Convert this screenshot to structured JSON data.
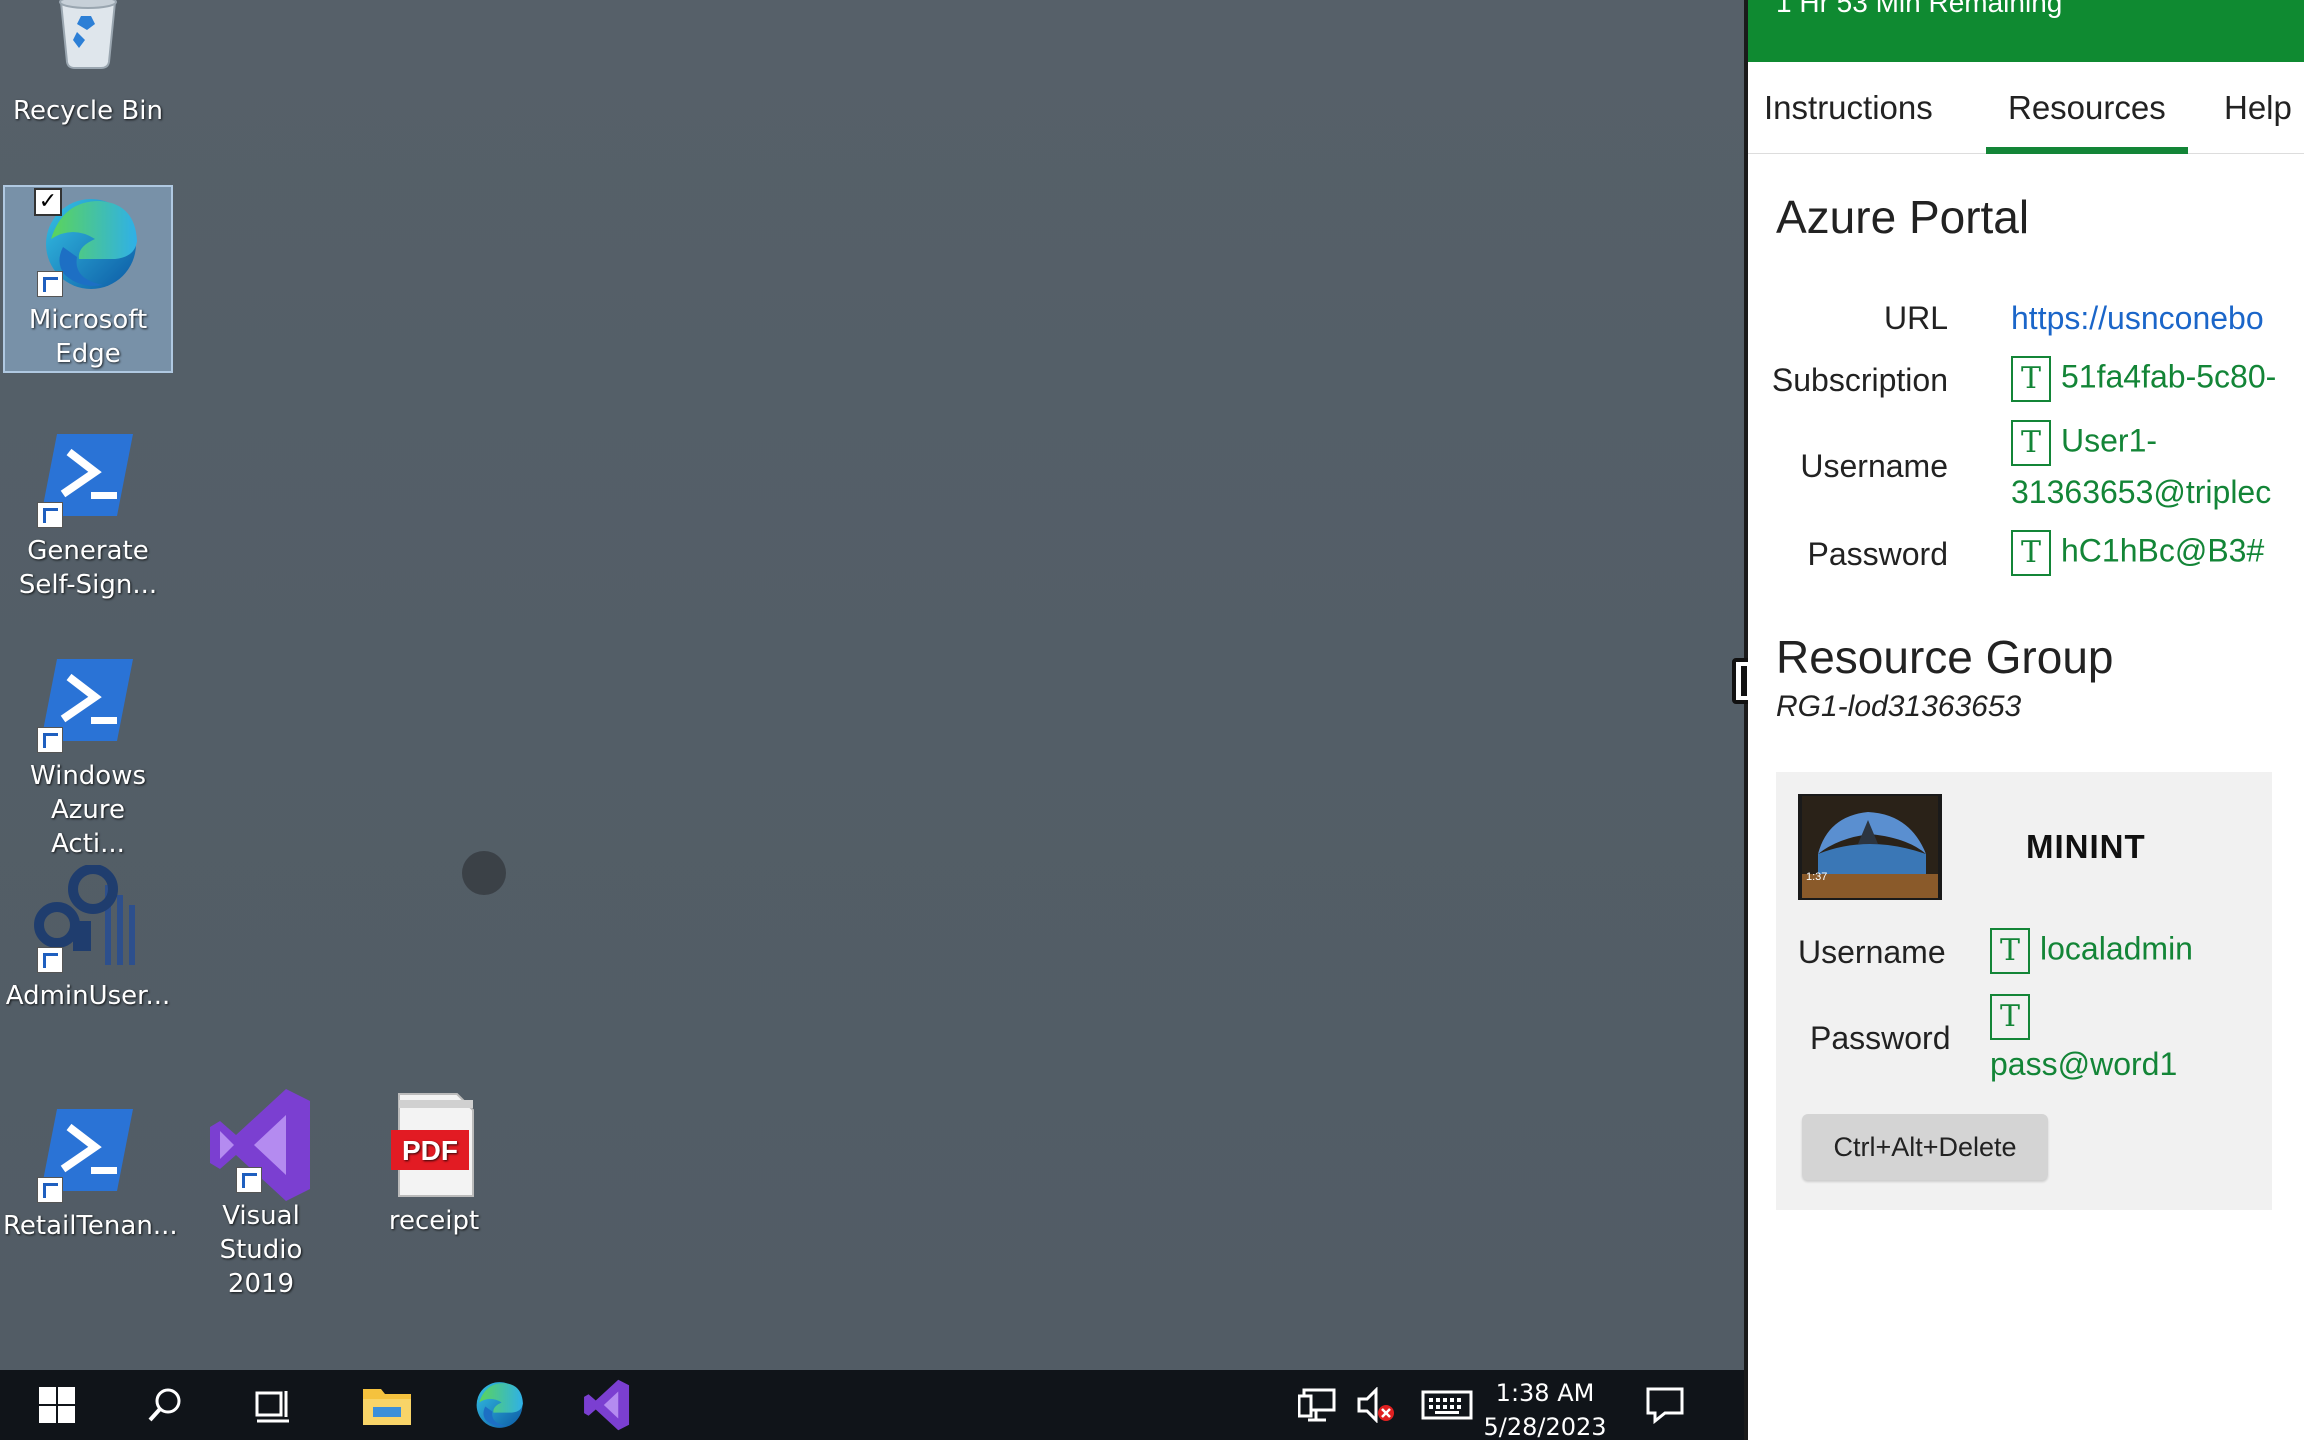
{
  "desktop": {
    "icons": [
      {
        "label": "Recycle Bin"
      },
      {
        "label": "Microsoft Edge"
      },
      {
        "label": "Generate Self-Sign..."
      },
      {
        "label": "Windows Azure Acti..."
      },
      {
        "label": "AdminUser..."
      },
      {
        "label": "RetailTenan..."
      },
      {
        "label": "Visual Studio 2019"
      },
      {
        "label": "receipt"
      }
    ],
    "pdf_badge": "PDF"
  },
  "taskbar": {
    "time": "1:38 AM",
    "date": "5/28/2023",
    "buttons": [
      "start-icon",
      "search-icon",
      "task-view-icon",
      "file-explorer-icon",
      "edge-icon",
      "visual-studio-icon"
    ],
    "tray": [
      "network-icon",
      "volume-muted-icon",
      "keyboard-icon",
      "notifications-icon"
    ]
  },
  "panel": {
    "timer": "1 Hr 53 Min Remaining",
    "tabs": [
      "Instructions",
      "Resources",
      "Help"
    ],
    "active_tab": "Resources",
    "azure_portal": {
      "heading": "Azure Portal",
      "url_label": "URL",
      "url_value": "https://usnconebo",
      "subscription_label": "Subscription",
      "subscription_value": "51fa4fab-5c80-",
      "username_label": "Username",
      "username_line1": "User1-",
      "username_line2": "31363653@triplec",
      "password_label": "Password",
      "password_value": "hC1hBc@B3#",
      "type_icon": "T"
    },
    "resource_group": {
      "heading": "Resource Group",
      "name": "RG1-lod31363653"
    },
    "vm": {
      "name": "MININT",
      "thumb_time": "1:37",
      "username_label": "Username",
      "username_value": "localadmin",
      "password_label": "Password",
      "password_value": "pass@word1",
      "cad_button": "Ctrl+Alt+Delete"
    }
  },
  "colors": {
    "timer_green": "#0f8a31",
    "accent_green": "#138537",
    "link_blue": "#1b66c9",
    "desktop_bg": "#525d66",
    "taskbar_bg": "#101419"
  }
}
